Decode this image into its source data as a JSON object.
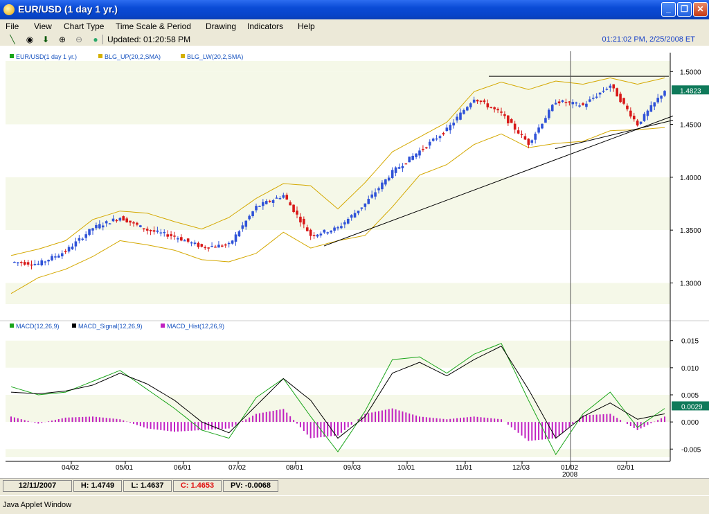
{
  "window": {
    "title": "EUR/USD (1 day  1 yr.)",
    "applet_status": "Java Applet Window"
  },
  "menu": [
    "File",
    "View",
    "Chart Type",
    "Time Scale & Period",
    "Drawing",
    "Indicators",
    "Help"
  ],
  "toolbar": {
    "icons": [
      "pencil-icon",
      "crosshair-icon",
      "arrow-down-icon",
      "zoom-in-icon",
      "zoom-out-icon",
      "globe-icon"
    ],
    "updated": "Updated: 01:20:58 PM",
    "clock": "01:21:02 PM, 2/25/2008 ET"
  },
  "price_panel": {
    "legend": [
      "EUR/USD(1 day  1 yr.)",
      "BLG_UP(20,2,SMA)",
      "BLG_LW(20,2,SMA)"
    ],
    "legend_colors": [
      "#1aa51a",
      "#d4b000",
      "#d4b000"
    ],
    "yticks": [
      "1.5000",
      "1.4500",
      "1.4000",
      "1.3500",
      "1.3000"
    ],
    "last_price": "1.4823"
  },
  "macd_panel": {
    "legend": [
      "MACD(12,26,9)",
      "MACD_Signal(12,26,9)",
      "MACD_Hist(12,26,9)"
    ],
    "legend_colors": [
      "#1aa51a",
      "#000000",
      "#c020c0"
    ],
    "yticks": [
      "0.015",
      "0.010",
      "0.005",
      "0.000",
      "-0.005"
    ],
    "last_value": "0.0029"
  },
  "xaxis": {
    "labels": [
      "04/02",
      "05/01",
      "06/01",
      "07/02",
      "08/01",
      "09/03",
      "10/01",
      "11/01",
      "12/03",
      "01/02",
      "02/01"
    ],
    "year_label": "2008"
  },
  "status": {
    "date": "12/11/2007",
    "high": "H: 1.4749",
    "low": "L: 1.4637",
    "close": "C: 1.4653",
    "pv": "PV: -0.0068"
  },
  "chart_data": [
    {
      "type": "candlestick",
      "title": "EUR/USD(1 day  1 yr.)",
      "ylim": [
        1.28,
        1.51
      ],
      "x": [
        "03/01",
        "03/15",
        "04/02",
        "04/16",
        "05/01",
        "05/15",
        "06/01",
        "06/15",
        "07/02",
        "07/16",
        "08/01",
        "08/15",
        "09/03",
        "09/17",
        "10/01",
        "10/15",
        "11/01",
        "11/15",
        "12/03",
        "12/17",
        "01/02",
        "01/16",
        "02/01",
        "02/15",
        "02/25"
      ],
      "close": [
        1.32,
        1.318,
        1.33,
        1.352,
        1.362,
        1.35,
        1.344,
        1.334,
        1.336,
        1.372,
        1.383,
        1.345,
        1.352,
        1.375,
        1.405,
        1.425,
        1.445,
        1.475,
        1.46,
        1.432,
        1.472,
        1.468,
        1.487,
        1.45,
        1.4823
      ],
      "series": [
        {
          "name": "BLG_UP(20,2,SMA)",
          "values": [
            1.326,
            1.332,
            1.34,
            1.36,
            1.368,
            1.366,
            1.358,
            1.351,
            1.362,
            1.38,
            1.394,
            1.392,
            1.37,
            1.395,
            1.424,
            1.438,
            1.452,
            1.481,
            1.49,
            1.483,
            1.491,
            1.488,
            1.494,
            1.488,
            1.494
          ]
        },
        {
          "name": "BLG_LW(20,2,SMA)",
          "values": [
            1.29,
            1.305,
            1.313,
            1.325,
            1.34,
            1.336,
            1.331,
            1.322,
            1.32,
            1.328,
            1.348,
            1.333,
            1.34,
            1.345,
            1.372,
            1.402,
            1.412,
            1.431,
            1.441,
            1.428,
            1.432,
            1.434,
            1.444,
            1.445,
            1.447
          ]
        }
      ]
    },
    {
      "type": "line",
      "title": "MACD(12,26,9)",
      "ylim": [
        -0.0065,
        0.0165
      ],
      "x": [
        "03/01",
        "03/15",
        "04/02",
        "04/16",
        "05/01",
        "05/15",
        "06/01",
        "06/15",
        "07/02",
        "07/16",
        "08/01",
        "08/15",
        "09/03",
        "09/17",
        "10/01",
        "10/15",
        "11/01",
        "11/15",
        "12/03",
        "12/17",
        "01/02",
        "01/16",
        "02/01",
        "02/15",
        "02/25"
      ],
      "series": [
        {
          "name": "MACD(12,26,9)",
          "values": [
            0.0065,
            0.005,
            0.0055,
            0.0075,
            0.0095,
            0.006,
            0.0025,
            -0.0015,
            -0.003,
            0.0045,
            0.008,
            0.001,
            -0.0055,
            0.002,
            0.0115,
            0.012,
            0.009,
            0.0125,
            0.0145,
            0.004,
            -0.006,
            0.0015,
            0.0055,
            -0.001,
            0.0025
          ]
        },
        {
          "name": "MACD_Signal(12,26,9)",
          "values": [
            0.0055,
            0.0052,
            0.0057,
            0.0068,
            0.009,
            0.007,
            0.004,
            0.0,
            -0.002,
            0.003,
            0.008,
            0.004,
            -0.003,
            0.001,
            0.009,
            0.011,
            0.0085,
            0.0115,
            0.014,
            0.006,
            -0.003,
            0.001,
            0.0035,
            0.0005,
            0.0015
          ]
        },
        {
          "name": "MACD_Hist(12,26,9)",
          "values": [
            0.001,
            -0.0003,
            0.0008,
            0.001,
            0.0005,
            -0.0012,
            -0.0018,
            -0.0015,
            -0.0012,
            0.0015,
            0.0024,
            -0.003,
            -0.0025,
            0.0015,
            0.0025,
            0.001,
            0.0005,
            0.001,
            0.0005,
            -0.0035,
            -0.003,
            0.0012,
            0.0015,
            -0.0015,
            0.001
          ]
        }
      ]
    }
  ]
}
